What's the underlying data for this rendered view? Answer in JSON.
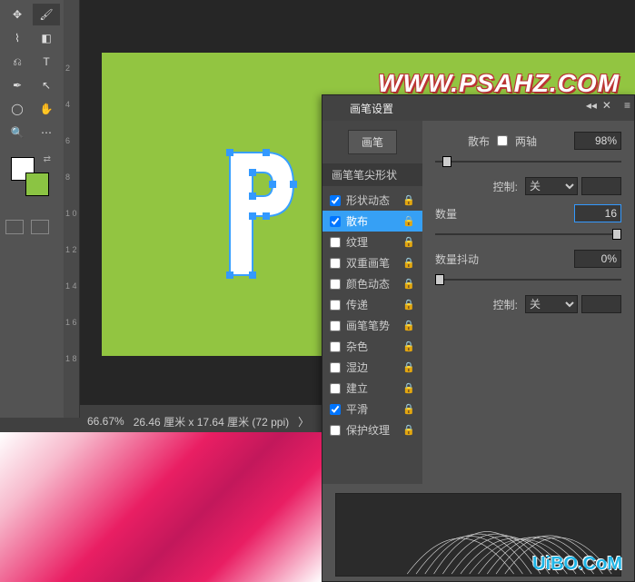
{
  "toolbar": {
    "tools": [
      "move",
      "brush",
      "lasso",
      "eraser",
      "clone",
      "type",
      "pen",
      "arrow",
      "ellipse",
      "hand",
      "zoom",
      "more"
    ]
  },
  "ruler": {
    "marks": [
      "",
      "2",
      "4",
      "6",
      "8",
      "1 0",
      "1 2",
      "1 4",
      "1 6",
      "1 8"
    ]
  },
  "canvas": {
    "watermark": "WWW.PSAHZ.COM"
  },
  "status": {
    "zoom": "66.67%",
    "dims": "26.46 厘米 x 17.64 厘米 (72 ppi)",
    "arrow": "〉"
  },
  "panel": {
    "title": "画笔设置",
    "brush_btn": "画笔",
    "tip_shape": "画笔笔尖形状",
    "options": [
      {
        "label": "形状动态",
        "checked": true
      },
      {
        "label": "散布",
        "checked": true,
        "selected": true
      },
      {
        "label": "纹理",
        "checked": false
      },
      {
        "label": "双重画笔",
        "checked": false
      },
      {
        "label": "颜色动态",
        "checked": false
      },
      {
        "label": "传递",
        "checked": false
      },
      {
        "label": "画笔笔势",
        "checked": false
      },
      {
        "label": "杂色",
        "checked": false
      },
      {
        "label": "湿边",
        "checked": false
      },
      {
        "label": "建立",
        "checked": false
      },
      {
        "label": "平滑",
        "checked": true
      },
      {
        "label": "保护纹理",
        "checked": false
      }
    ],
    "settings": {
      "scatter_label": "散布",
      "both_axes": "两轴",
      "scatter_val": "98%",
      "control_label": "控制:",
      "control_val": "关",
      "count_label": "数量",
      "count_val": "16",
      "jitter_label": "数量抖动",
      "jitter_val": "0%"
    }
  },
  "uibo": "UiBO.CoM"
}
